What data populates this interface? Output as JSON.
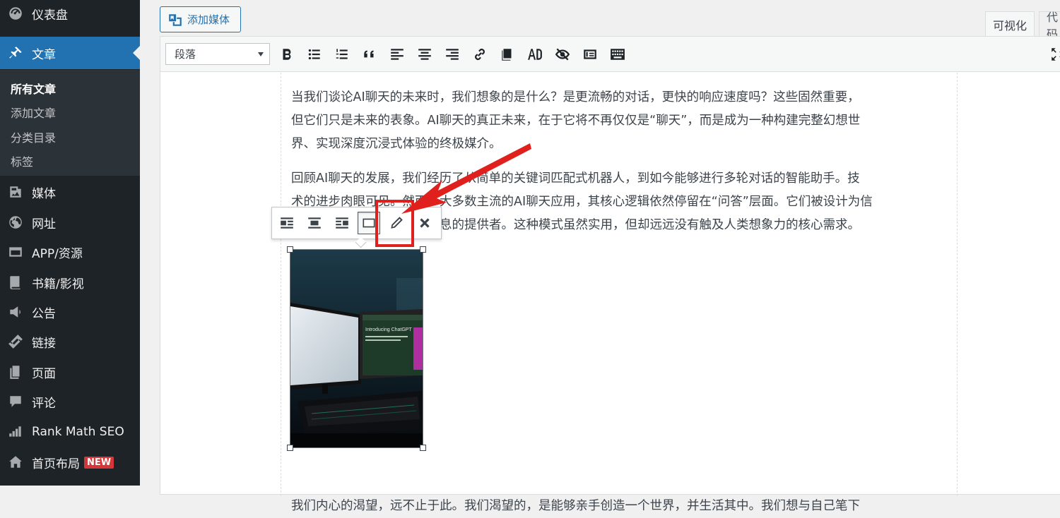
{
  "sidebar": {
    "items": [
      {
        "label": "仪表盘",
        "icon": "dashboard-icon"
      },
      {
        "label": "文章",
        "icon": "pin-icon",
        "active": true
      },
      {
        "label": "媒体",
        "icon": "media-icon"
      },
      {
        "label": "网址",
        "icon": "globe-icon"
      },
      {
        "label": "APP/资源",
        "icon": "window-icon"
      },
      {
        "label": "书籍/影视",
        "icon": "book-icon"
      },
      {
        "label": "公告",
        "icon": "megaphone-icon"
      },
      {
        "label": "链接",
        "icon": "link-icon"
      },
      {
        "label": "页面",
        "icon": "page-icon"
      },
      {
        "label": "评论",
        "icon": "comment-icon"
      },
      {
        "label": "Rank Math SEO",
        "icon": "chart-icon"
      },
      {
        "label": "首页布局",
        "icon": "home-icon",
        "badge": "NEW"
      }
    ],
    "submenu": [
      "所有文章",
      "添加文章",
      "分类目录",
      "标签"
    ]
  },
  "editor": {
    "add_media_label": "添加媒体",
    "tabs": {
      "visual": "可视化",
      "code": "代码"
    },
    "format_select": "段落",
    "toolbar_icons": [
      "bold-icon",
      "bullet-list-icon",
      "numbered-list-icon",
      "blockquote-icon",
      "align-left-icon",
      "align-center-icon",
      "align-right-icon",
      "link-icon",
      "read-more-icon",
      "ad-icon",
      "hide-icon",
      "shortcode-icon",
      "keyboard-icon",
      "fullscreen-icon"
    ],
    "image_toolbar_icons": [
      "align-left-icon",
      "align-center-icon",
      "align-right-icon",
      "no-align-icon",
      "pencil-icon",
      "remove-icon"
    ]
  },
  "content": {
    "p1": [
      "当我们谈论AI聊天的未来时，我们想象的是什么？是更流畅的对话，更快的响应速度吗？这些固然重要，",
      "但它们只是未来的表象。AI聊天的真正未来，在于它将不再仅仅是“聊天”，而是成为一种构建完整幻想世",
      "界、实现深度沉浸式体验的终极媒介。"
    ],
    "p2": [
      "回顾AI聊天的发展，我们经历了从简单的关键词匹配式机器人，到如今能够进行多轮对话的智能助手。技",
      "术的进步肉眼可见。然而，大多数主流的AI聊天应用，其核心逻辑依然停留在“问答”层面。它们被设计为信",
      "息的提供者。这种模式虽然实用，但却远远没有触及人类想象力的核心需求。"
    ],
    "p3": "我们内心的渴望，远不止于此。我们渴望的，是能够亲手创造一个世界，并生活其中。我们想与自己笔下",
    "image_title": "Introducing ChatGPT"
  },
  "colors": {
    "sidebar_bg": "#1d2327",
    "accent": "#2271b1",
    "highlight": "#e0201c"
  }
}
